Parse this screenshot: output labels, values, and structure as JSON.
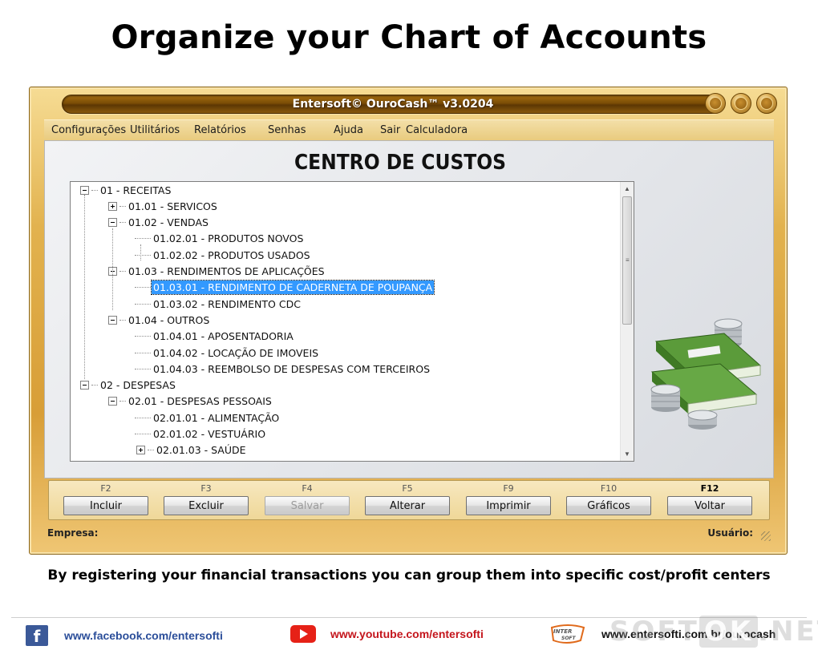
{
  "page": {
    "title": "Organize your Chart of Accounts",
    "caption": "By registering your financial transactions you can group them into specific cost/profit centers"
  },
  "window": {
    "title": "Entersoft© OuroCash™ v3.0204",
    "menu": [
      "Configurações",
      "Utilitários",
      "Relatórios",
      "Senhas",
      "Ajuda",
      "Sair",
      "Calculadora"
    ]
  },
  "screen": {
    "title": "CENTRO DE CUSTOS",
    "tree": [
      {
        "label": "01 - RECEITAS",
        "level": 0,
        "expander": "minus"
      },
      {
        "label": "01.01 - SERVICOS",
        "level": 1,
        "expander": "plus"
      },
      {
        "label": "01.02 - VENDAS",
        "level": 1,
        "expander": "minus"
      },
      {
        "label": "01.02.01 - PRODUTOS NOVOS",
        "level": 2,
        "expander": "none"
      },
      {
        "label": "01.02.02 - PRODUTOS USADOS",
        "level": 2,
        "expander": "none"
      },
      {
        "label": "01.03 - RENDIMENTOS DE APLICAÇÕES",
        "level": 1,
        "expander": "minus"
      },
      {
        "label": "01.03.01 - RENDIMENTO DE CADERNETA DE POUPANÇA",
        "level": 2,
        "expander": "none",
        "selected": true
      },
      {
        "label": "01.03.02 - RENDIMENTO CDC",
        "level": 2,
        "expander": "none"
      },
      {
        "label": "01.04 - OUTROS",
        "level": 1,
        "expander": "minus"
      },
      {
        "label": "01.04.01 - APOSENTADORIA",
        "level": 2,
        "expander": "none"
      },
      {
        "label": "01.04.02 - LOCAÇÃO DE IMOVEIS",
        "level": 2,
        "expander": "none"
      },
      {
        "label": "01.04.03 - REEMBOLSO DE DESPESAS COM TERCEIROS",
        "level": 2,
        "expander": "none"
      },
      {
        "label": "02 - DESPESAS",
        "level": 0,
        "expander": "minus"
      },
      {
        "label": "02.01 - DESPESAS PESSOAIS",
        "level": 1,
        "expander": "minus"
      },
      {
        "label": "02.01.01 - ALIMENTAÇÃO",
        "level": 2,
        "expander": "none"
      },
      {
        "label": "02.01.02 - VESTUÁRIO",
        "level": 2,
        "expander": "none"
      },
      {
        "label": "02.01.03 - SAÚDE",
        "level": 2,
        "expander": "plus"
      }
    ]
  },
  "function_keys": [
    {
      "key": "F2",
      "label": "Incluir",
      "enabled": true
    },
    {
      "key": "F3",
      "label": "Excluir",
      "enabled": true
    },
    {
      "key": "F4",
      "label": "Salvar",
      "enabled": false
    },
    {
      "key": "F5",
      "label": "Alterar",
      "enabled": true
    },
    {
      "key": "F9",
      "label": "Imprimir",
      "enabled": true
    },
    {
      "key": "F10",
      "label": "Gráficos",
      "enabled": true
    },
    {
      "key": "F12",
      "label": "Voltar",
      "enabled": true,
      "bold_key": true
    }
  ],
  "status": {
    "left": "Empresa:",
    "right": "Usuário:"
  },
  "footer": {
    "facebook": "www.facebook.com/entersofti",
    "youtube": "www.youtube.com/entersofti",
    "logo_text": "INTER SOFT",
    "site": "www.entersofti.com.br/ourocash",
    "watermark": [
      "SOFT",
      "OK",
      ".NET"
    ]
  },
  "colors": {
    "frame_gold": "#e2b24e",
    "title_bar_brown": "#7a4c06",
    "selection": "#3399ff",
    "facebook_text": "#2b4e9a",
    "youtube_text": "#c4151c"
  }
}
